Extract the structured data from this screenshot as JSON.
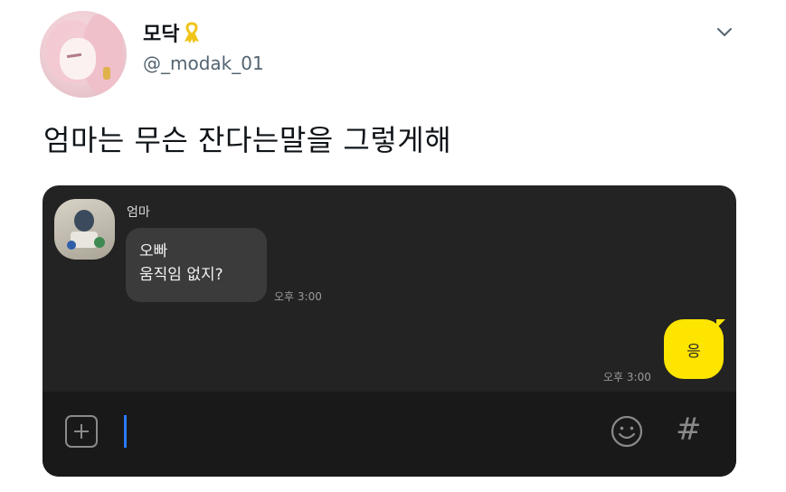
{
  "tweet": {
    "display_name": "모닥",
    "handle": "@_modak_01",
    "text": "엄마는 무슨 잔다는말을 그렇게해",
    "icons": {
      "badge": "yellow-ribbon-icon",
      "menu": "chevron-down-icon"
    }
  },
  "chat": {
    "sender_name": "엄마",
    "incoming_message": {
      "lines": [
        "오빠",
        "움직임 없지?"
      ],
      "time": "오후 3:00"
    },
    "outgoing_message": {
      "text": "응",
      "time": "오후 3:00"
    },
    "input_bar": {
      "plus_icon": "plus-square-icon",
      "emoji_icon": "emoji-smile-icon",
      "hash_label": "#"
    },
    "colors": {
      "background": "#232323",
      "incoming_bubble": "#3b3b3b",
      "outgoing_bubble": "#fee500",
      "cursor": "#2a7bff"
    }
  }
}
